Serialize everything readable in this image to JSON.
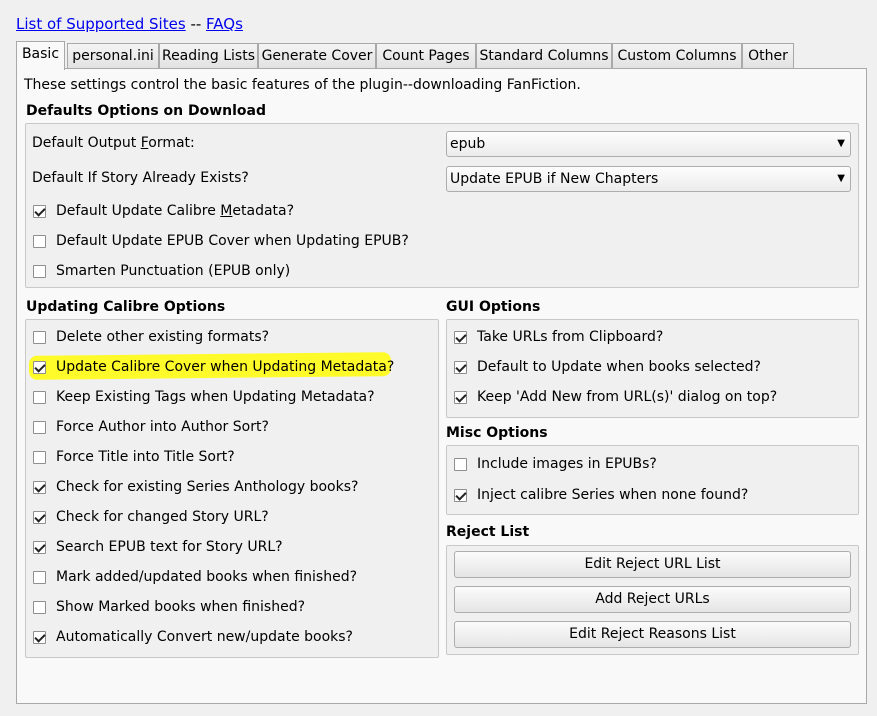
{
  "links": {
    "supported_sites": "List of Supported Sites",
    "separator": "--",
    "faqs": "FAQs"
  },
  "tabs": [
    {
      "label": "Basic"
    },
    {
      "label": "personal.ini"
    },
    {
      "label": "Reading Lists"
    },
    {
      "label": "Generate Cover"
    },
    {
      "label": "Count Pages"
    },
    {
      "label": "Standard Columns"
    },
    {
      "label": "Custom Columns"
    },
    {
      "label": "Other"
    }
  ],
  "description": "These settings control the basic features of the plugin--downloading FanFiction.",
  "defaults": {
    "heading": "Defaults Options on Download",
    "output_format_label_pre": "Default Output ",
    "output_format_label_u": "F",
    "output_format_label_post": "ormat:",
    "output_format_value": "epub",
    "story_exists_label": "Default If Story Already Exists?",
    "story_exists_value": "Update EPUB if New Chapters",
    "update_metadata_pre": "Default Update Calibre ",
    "update_metadata_u": "M",
    "update_metadata_post": "etadata?",
    "update_metadata_checked": true,
    "update_cover": "Default Update EPUB Cover when Updating EPUB?",
    "update_cover_checked": false,
    "smarten": "Smarten Punctuation (EPUB only)",
    "smarten_checked": false
  },
  "calibre": {
    "heading": "Updating Calibre Options",
    "items": [
      {
        "label": "Delete other existing formats?",
        "checked": false
      },
      {
        "label": "Update Calibre Cover when Updating Metadata?",
        "checked": true
      },
      {
        "label": "Keep Existing Tags when Updating Metadata?",
        "checked": false
      },
      {
        "label": "Force Author into Author Sort?",
        "checked": false
      },
      {
        "label": "Force Title into Title Sort?",
        "checked": false
      },
      {
        "label": "Check for existing Series Anthology books?",
        "checked": true
      },
      {
        "label": "Check for changed Story URL?",
        "checked": true
      },
      {
        "label": "Search EPUB text for Story URL?",
        "checked": true
      },
      {
        "label": "Mark added/updated books when finished?",
        "checked": false
      },
      {
        "label": "Show Marked books when finished?",
        "checked": false
      },
      {
        "label": "Automatically Convert new/update books?",
        "checked": true
      }
    ]
  },
  "gui": {
    "heading": "GUI Options",
    "items": [
      {
        "label": "Take URLs from Clipboard?",
        "checked": true
      },
      {
        "label": "Default to Update when books selected?",
        "checked": true
      },
      {
        "label": "Keep 'Add New from URL(s)' dialog on top?",
        "checked": true
      }
    ]
  },
  "misc": {
    "heading": "Misc Options",
    "items": [
      {
        "label": "Include images in EPUBs?",
        "checked": false
      },
      {
        "label": "Inject calibre Series when none found?",
        "checked": true
      }
    ]
  },
  "reject": {
    "heading": "Reject List",
    "buttons": [
      {
        "label": "Edit Reject URL List"
      },
      {
        "label": "Add Reject URLs"
      },
      {
        "label": "Edit Reject Reasons List"
      }
    ]
  },
  "colors": {
    "highlight": "#fffb2a",
    "link": "#0000ee"
  }
}
